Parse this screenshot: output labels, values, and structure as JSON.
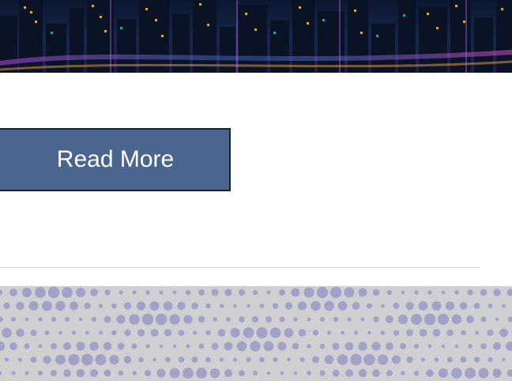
{
  "hero": {
    "image": "city-night-skyline"
  },
  "button": {
    "read_more_label": "Read More"
  },
  "pattern": {
    "image": "halftone-dot-pattern",
    "dot_color": "#9a9ac8",
    "background_color": "#d0d0d2"
  },
  "colors": {
    "button_bg": "#4a668f",
    "button_border": "#1c2433",
    "divider": "#d6d6d6"
  }
}
